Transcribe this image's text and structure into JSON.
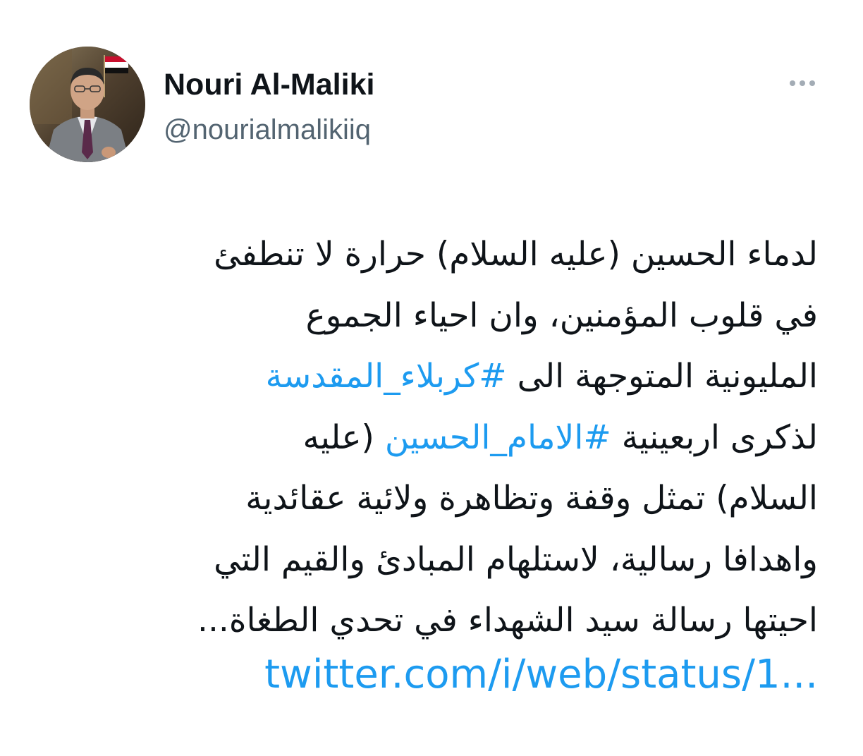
{
  "author": {
    "name": "Nouri Al-Maliki",
    "handle": "@nourialmalikiiq"
  },
  "more_icon": "more-horizontal-icon",
  "colors": {
    "link": "#1d9bf0",
    "text": "#0f1419",
    "secondary": "#536471"
  },
  "tweet": {
    "line1": "لدماء الحسين (عليه السلام) حرارة لا تنطفئ",
    "line2": "في قلوب المؤمنين، وان احياء الجموع",
    "line3_text": "المليونية المتوجهة الى ",
    "line3_hashtag": "#كربلاء_المقدسة",
    "line4_text_before": "لذكرى اربعينية ",
    "line4_hashtag": "#الامام_الحسين",
    "line4_text_after": " (عليه",
    "line5": "السلام) تمثل وقفة وتظاهرة ولائية عقائدية",
    "line6": "واهدافا رسالية، لاستلهام المبادئ والقيم التي",
    "line7": "احيتها رسالة سيد الشهداء في تحدي الطغاة...",
    "link": "twitter.com/i/web/status/1..."
  }
}
